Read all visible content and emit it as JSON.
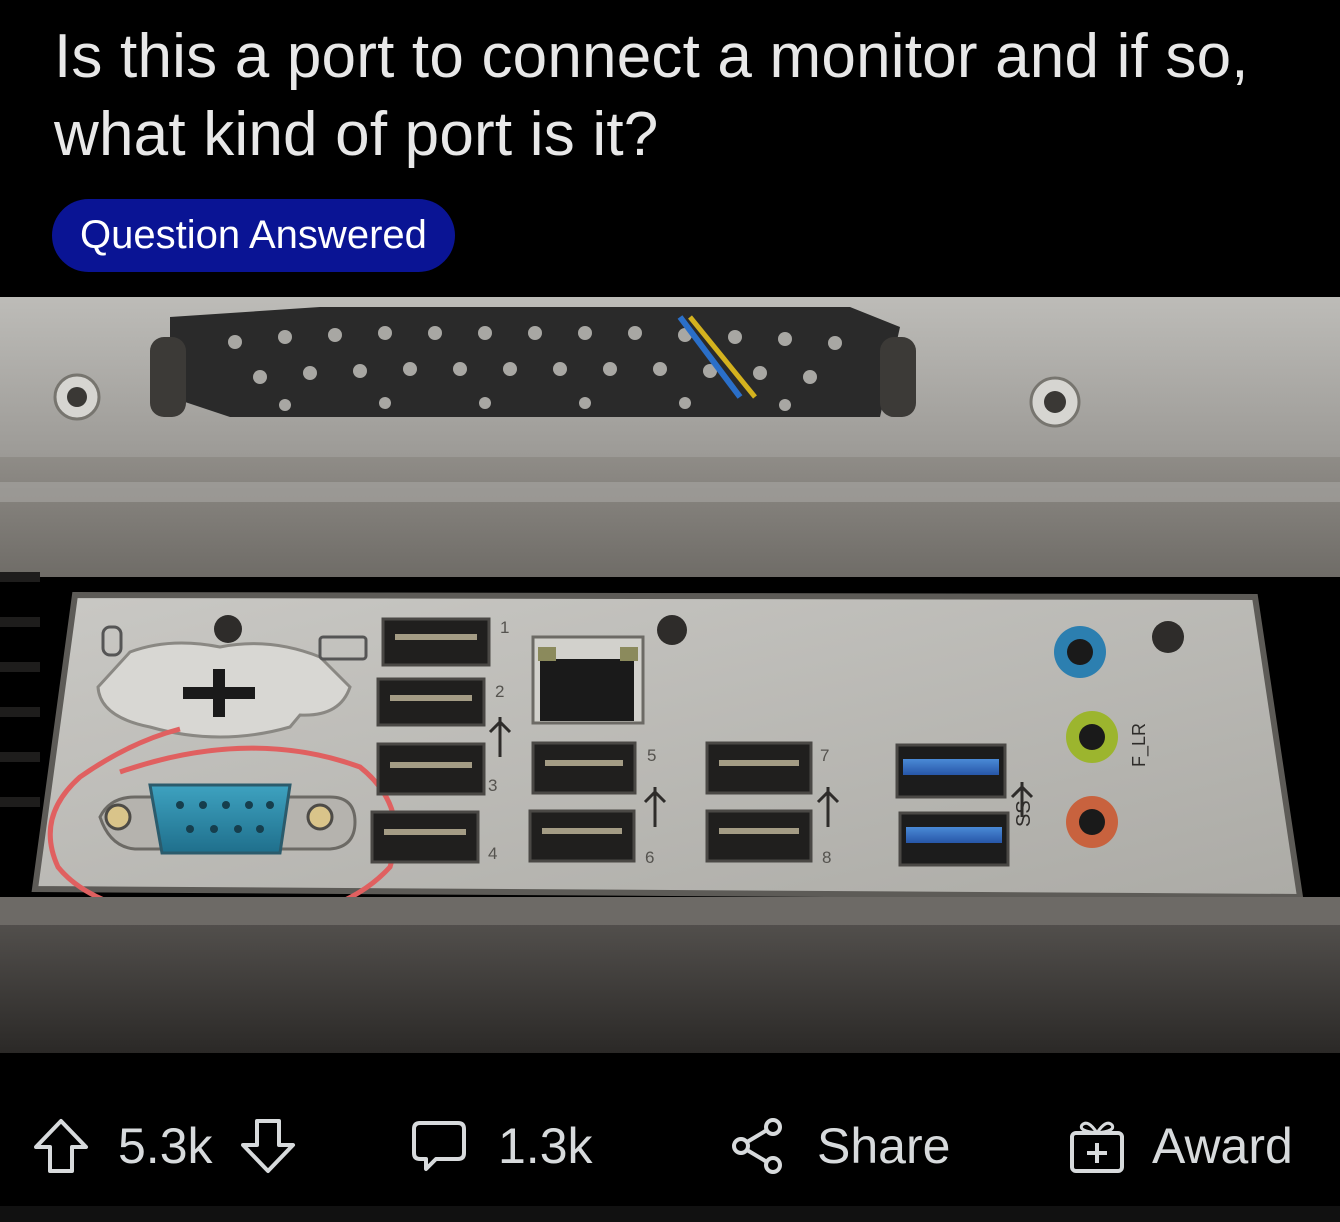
{
  "post": {
    "title": "Is this a port to connect a monitor and if so, what kind of port is it?",
    "flair": "Question Answered"
  },
  "image": {
    "usb_numbers": [
      "1",
      "2",
      "3",
      "4",
      "5",
      "6",
      "7",
      "8"
    ],
    "audio_label": "F_LR",
    "usb3_label": "SS"
  },
  "actions": {
    "upvotes": "5.3k",
    "comments": "1.3k",
    "share_label": "Share",
    "award_label": "Award"
  },
  "colors": {
    "background": "#000000",
    "flair_bg": "#0a1494",
    "circle_annotation": "#e06060",
    "vga_port": "#2f8fb0"
  }
}
